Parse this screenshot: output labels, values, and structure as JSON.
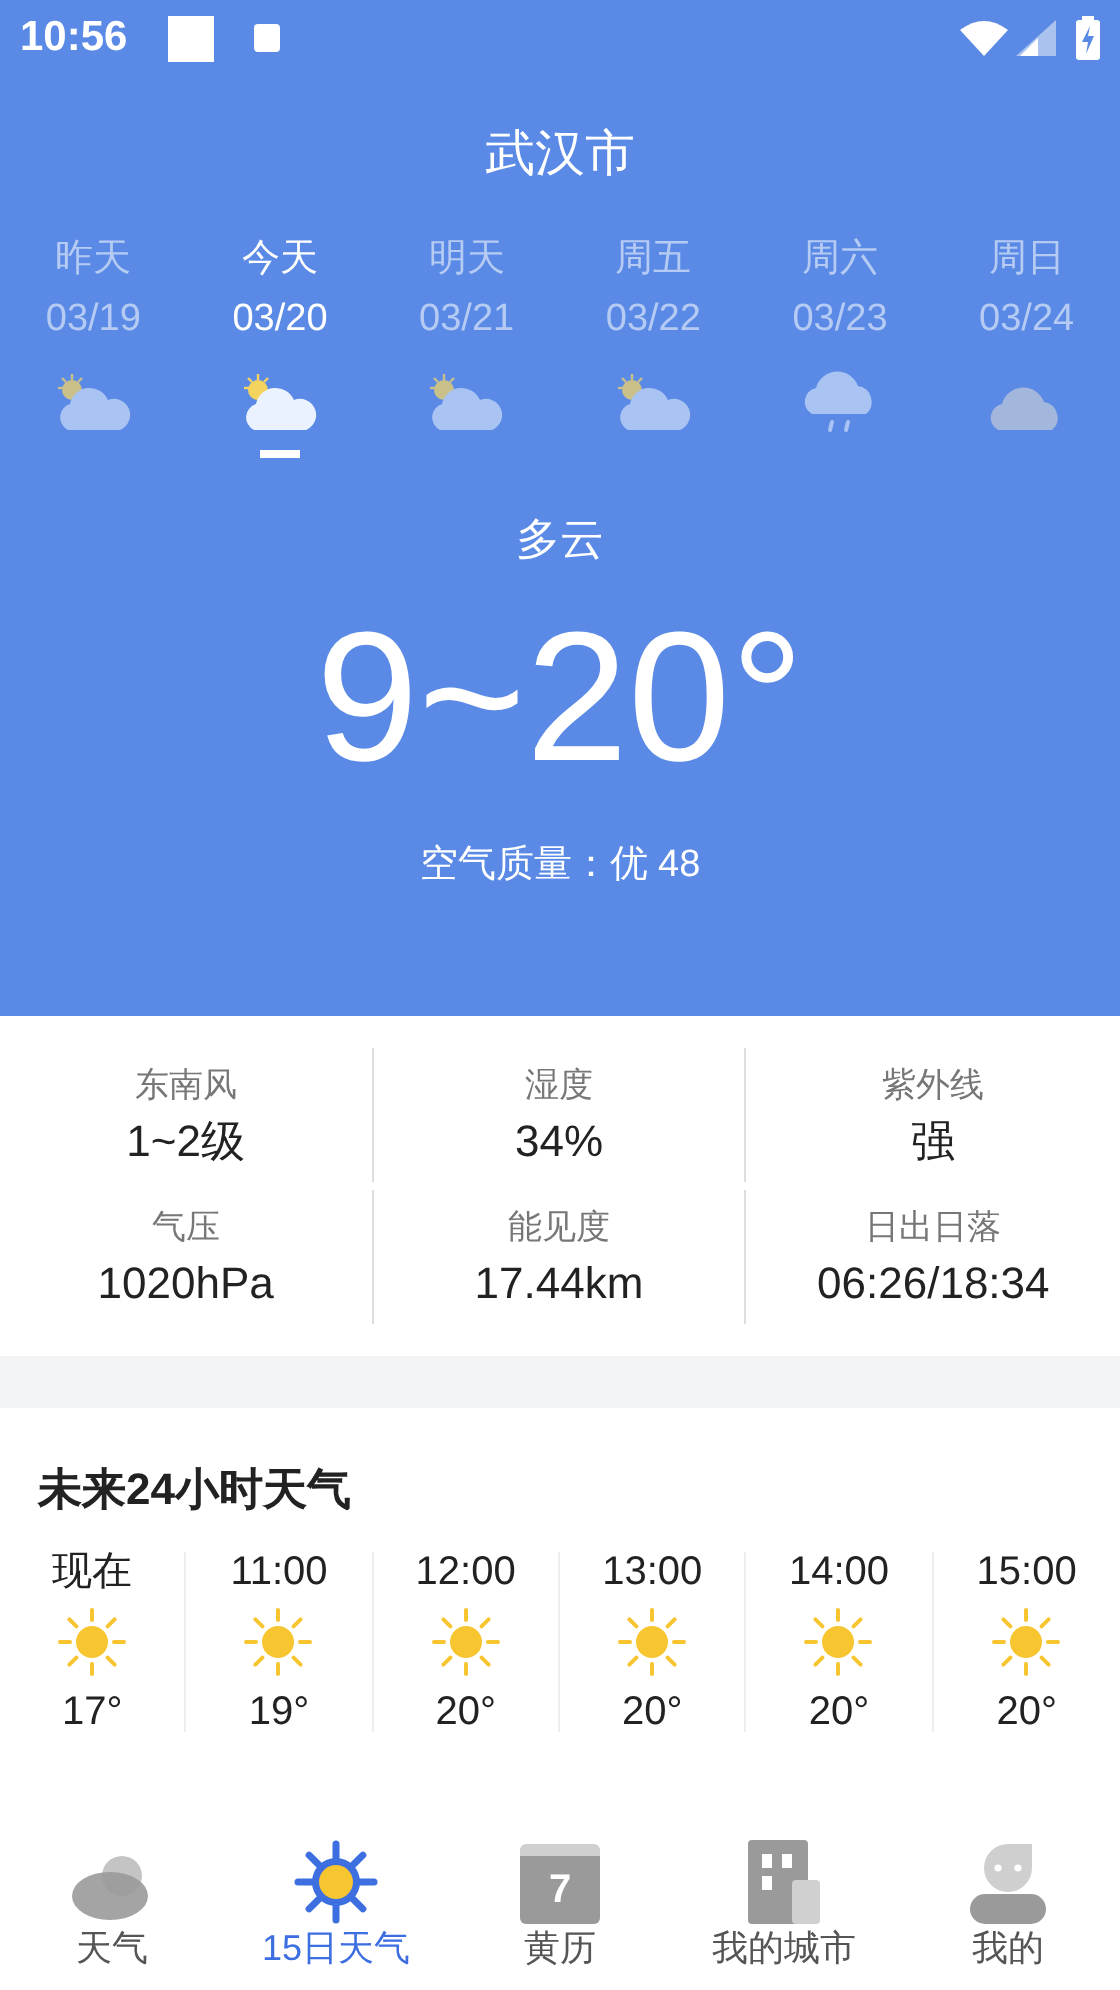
{
  "status_bar": {
    "time": "10:56"
  },
  "city": "武汉市",
  "days": [
    {
      "label": "昨天",
      "date": "03/19",
      "kind": "partly_cloudy",
      "selected": false
    },
    {
      "label": "今天",
      "date": "03/20",
      "kind": "partly_cloudy",
      "selected": true
    },
    {
      "label": "明天",
      "date": "03/21",
      "kind": "partly_cloudy",
      "selected": false
    },
    {
      "label": "周五",
      "date": "03/22",
      "kind": "partly_cloudy",
      "selected": false
    },
    {
      "label": "周六",
      "date": "03/23",
      "kind": "rain",
      "selected": false
    },
    {
      "label": "周日",
      "date": "03/24",
      "kind": "cloudy",
      "selected": false
    }
  ],
  "condition": "多云",
  "temperature": "9~20°",
  "air_quality": "空气质量：优 48",
  "details": [
    {
      "label": "东南风",
      "value": "1~2级"
    },
    {
      "label": "湿度",
      "value": "34%"
    },
    {
      "label": "紫外线",
      "value": "强"
    },
    {
      "label": "气压",
      "value": "1020hPa"
    },
    {
      "label": "能见度",
      "value": "17.44km"
    },
    {
      "label": "日出日落",
      "value": "06:26/18:34"
    }
  ],
  "hourly": {
    "title": "未来24小时天气",
    "hours": [
      {
        "time": "现在",
        "kind": "sunny",
        "temp": "17°"
      },
      {
        "time": "11:00",
        "kind": "sunny",
        "temp": "19°"
      },
      {
        "time": "12:00",
        "kind": "sunny",
        "temp": "20°"
      },
      {
        "time": "13:00",
        "kind": "sunny",
        "temp": "20°"
      },
      {
        "time": "14:00",
        "kind": "sunny",
        "temp": "20°"
      },
      {
        "time": "15:00",
        "kind": "sunny",
        "temp": "20°"
      }
    ]
  },
  "nav": [
    {
      "label": "天气",
      "kind": "weather",
      "selected": false
    },
    {
      "label": "15日天气",
      "kind": "forecast",
      "selected": true
    },
    {
      "label": "黄历",
      "kind": "calendar",
      "icon_text": "7",
      "selected": false
    },
    {
      "label": "我的城市",
      "kind": "city",
      "selected": false
    },
    {
      "label": "我的",
      "kind": "profile",
      "selected": false
    }
  ]
}
